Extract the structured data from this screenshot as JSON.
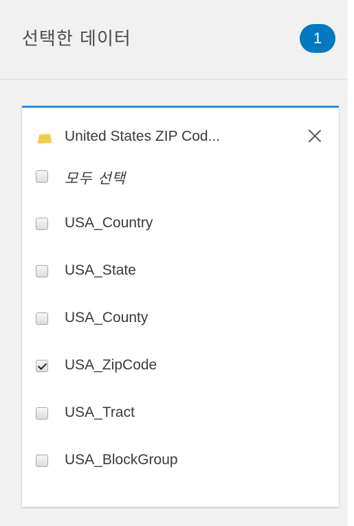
{
  "header": {
    "title": "선택한 데이터",
    "count": "1"
  },
  "colors": {
    "badge": "#0079c1",
    "card_top_border": "#2d8fd6",
    "layer_icon": "#f2cc4a"
  },
  "layer": {
    "icon": "layer-map-icon",
    "title": "United States ZIP Cod...",
    "close_icon": "close-icon"
  },
  "options": [
    {
      "label": "모두 선택",
      "checked": false
    },
    {
      "label": "USA_Country",
      "checked": false
    },
    {
      "label": "USA_State",
      "checked": false
    },
    {
      "label": "USA_County",
      "checked": false
    },
    {
      "label": "USA_ZipCode",
      "checked": true
    },
    {
      "label": "USA_Tract",
      "checked": false
    },
    {
      "label": "USA_BlockGroup",
      "checked": false
    }
  ]
}
